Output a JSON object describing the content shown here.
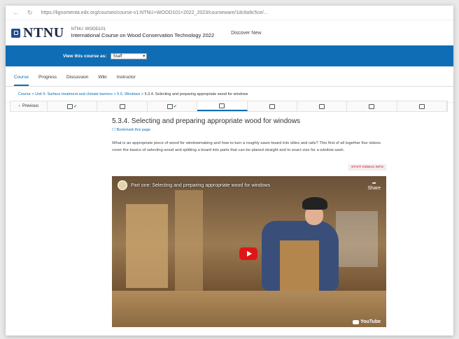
{
  "browser": {
    "url": "https://lignomenta.edx.org/courses/course-v1:NTNU+WOOD101+2022_2023/courseware/1dc8a9c5ce/..."
  },
  "header": {
    "logo_text": "NTNU",
    "course_code": "NTNU: WOOD101",
    "course_name": "International Course on Wood Conservation Technology 2022",
    "discover_label": "Discover New"
  },
  "view_bar": {
    "label": "View this course as:",
    "selected": "Staff"
  },
  "tabs": [
    {
      "label": "Course"
    },
    {
      "label": "Progress"
    },
    {
      "label": "Discussion"
    },
    {
      "label": "Wiki"
    },
    {
      "label": "Instructor"
    }
  ],
  "breadcrumb": {
    "course": "Course",
    "unit": "Unit 5: Surface treatment and climate barriers",
    "section": "5.5. Windows",
    "current": "5.3.4. Selecting and preparing appropriate wood for windows",
    "sep": ">"
  },
  "sequence_nav": {
    "previous_label": "Previous"
  },
  "unit": {
    "title": "5.3.4. Selecting and preparing appropriate wood for windows",
    "bookmark_label": "Bookmark this page",
    "description": "What is an appropriate piece of wood for windowmaking and how to turn a roughly sawn board into stiles and rails? This first of all together five videos cover the basics of selecting wood and splitting a board into parts that can be planed straight and to exact size for a window sash.",
    "debug_label": "STAFF DEBUG INFO"
  },
  "video": {
    "title": "Part one: Selecting and preparing appropriate wood for windows",
    "share_label": "Share",
    "brand": "YouTube"
  }
}
